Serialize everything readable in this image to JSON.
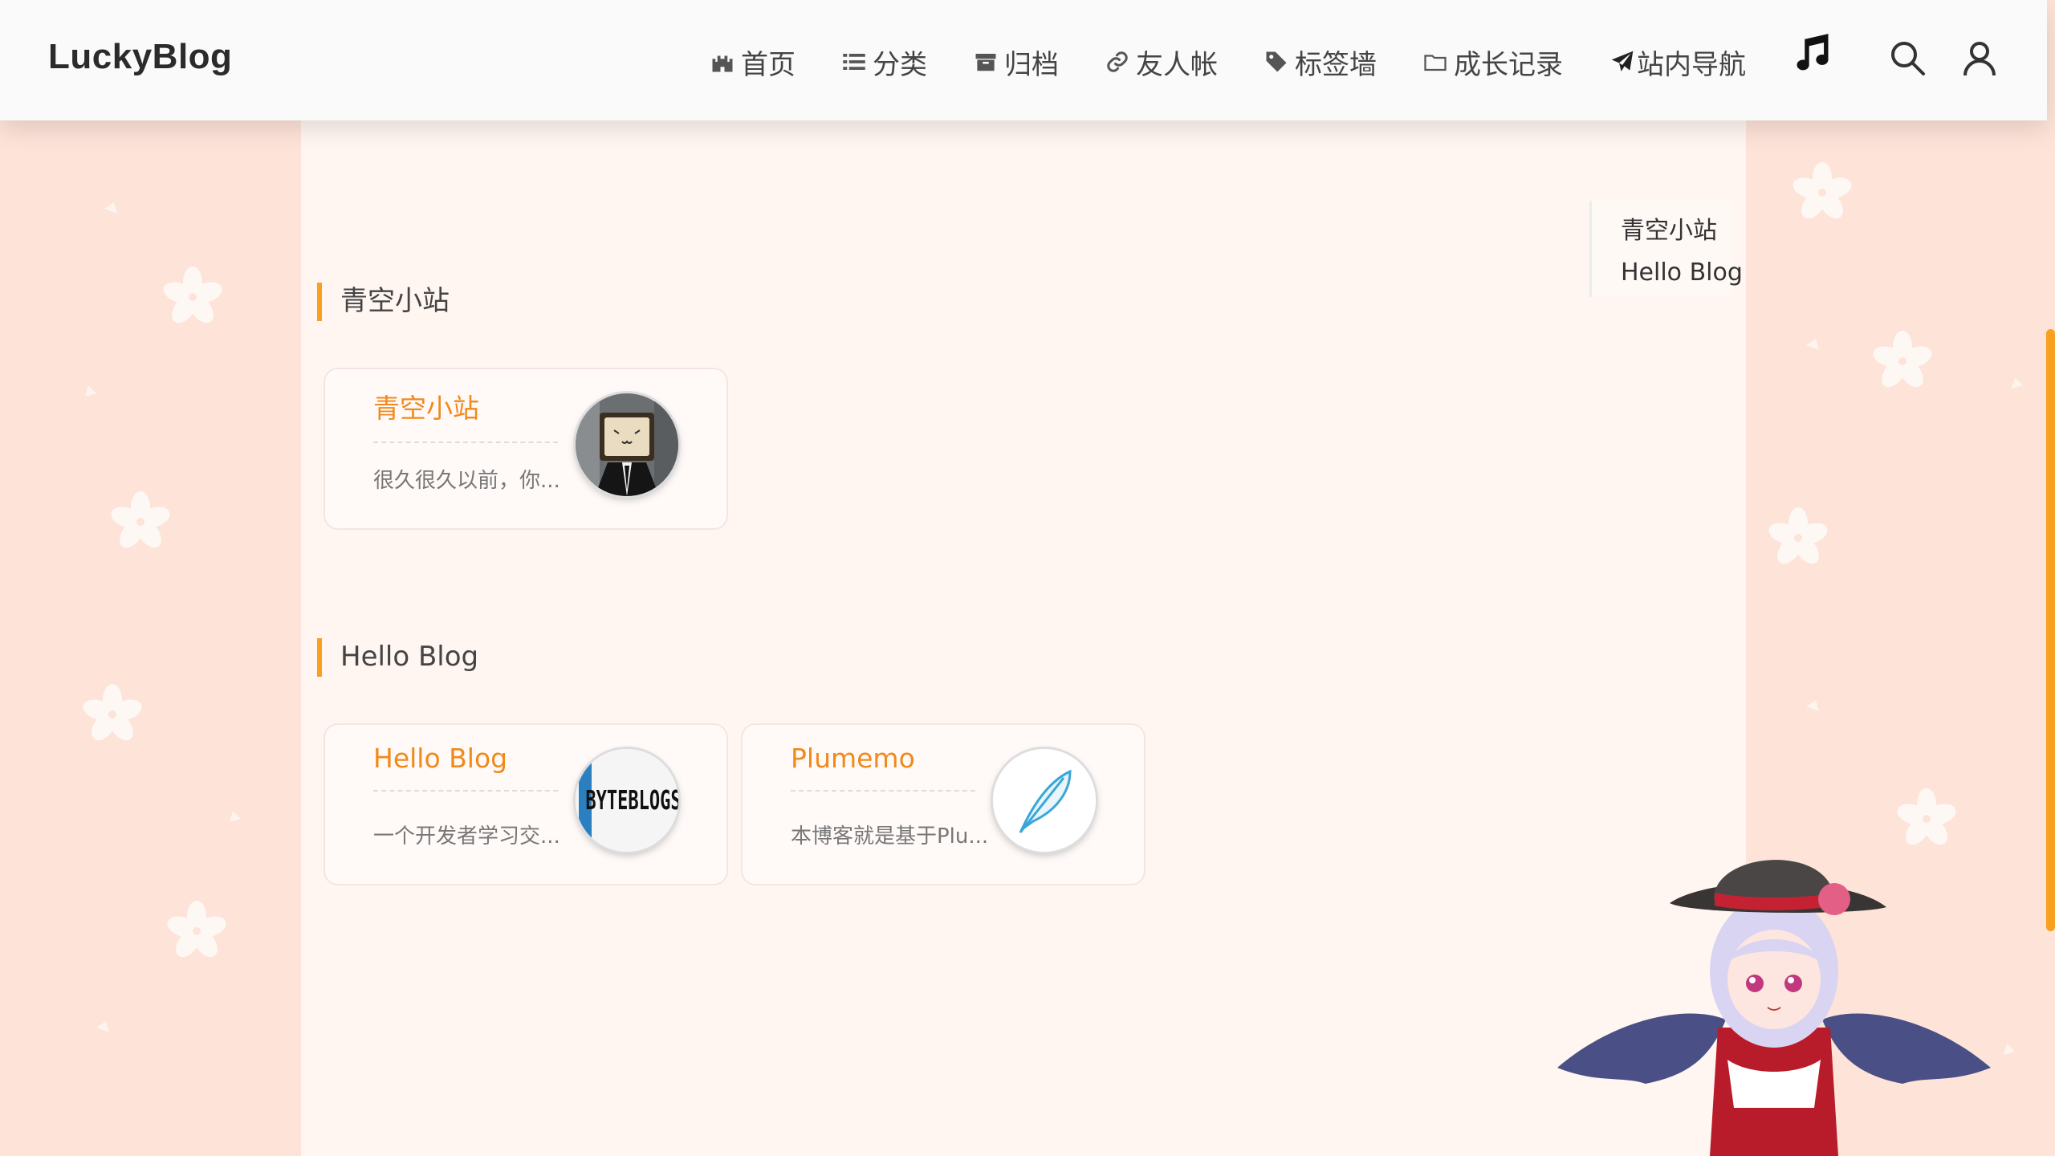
{
  "header": {
    "logo": "LuckyBlog",
    "nav": [
      {
        "label": "首页",
        "icon": "castle-icon"
      },
      {
        "label": "分类",
        "icon": "list-icon"
      },
      {
        "label": "归档",
        "icon": "archive-icon"
      },
      {
        "label": "友人帐",
        "icon": "link-icon"
      },
      {
        "label": "标签墙",
        "icon": "tag-icon"
      },
      {
        "label": "成长记录",
        "icon": "folder-icon"
      },
      {
        "label": "站内导航",
        "icon": "paper-plane-icon"
      }
    ],
    "music_icon": "music-note-icon",
    "search_icon": "search-icon",
    "user_icon": "user-icon"
  },
  "groups": [
    {
      "title": "青空小站",
      "links": [
        {
          "name": "青空小站",
          "desc": "很久很久以前，你...",
          "avatar": "tv-head-avatar"
        }
      ]
    },
    {
      "title": "Hello Blog",
      "links": [
        {
          "name": "Hello Blog",
          "desc": "一个开发者学习交...",
          "avatar": "byteblogs-avatar",
          "avatar_text": "BYTEBLOGS"
        },
        {
          "name": "Plumemo",
          "desc": "本博客就是基于Plu...",
          "avatar": "feather-avatar"
        }
      ]
    }
  ],
  "toc": [
    "青空小站",
    "Hello Blog"
  ],
  "colors": {
    "accent": "#f8a01f",
    "link_name": "#f08a1a",
    "page_bg": "#fde3d8",
    "panel_bg": "#fff7f3"
  }
}
